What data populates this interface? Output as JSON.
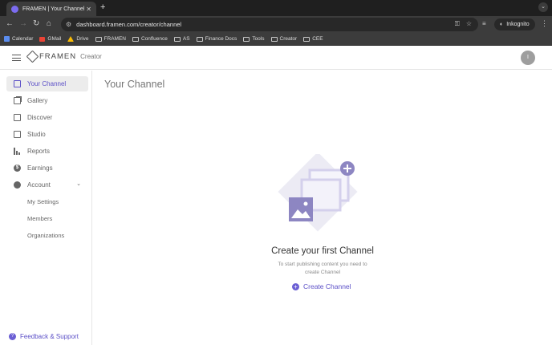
{
  "browser": {
    "tab_title": "FRAMEN | Your Channel",
    "url": "dashboard.framen.com/creator/channel",
    "incognito_label": "Inkognito",
    "bookmarks": [
      {
        "label": "Calendar",
        "icon": "calendar-icon"
      },
      {
        "label": "GMail",
        "icon": "gmail-icon"
      },
      {
        "label": "Drive",
        "icon": "drive-icon"
      },
      {
        "label": "FRAMEN",
        "icon": "folder-icon"
      },
      {
        "label": "Confluence",
        "icon": "folder-icon"
      },
      {
        "label": "AS",
        "icon": "folder-icon"
      },
      {
        "label": "Finance Docs",
        "icon": "folder-icon"
      },
      {
        "label": "Tools",
        "icon": "folder-icon"
      },
      {
        "label": "Creator",
        "icon": "folder-icon"
      },
      {
        "label": "CEE",
        "icon": "folder-icon"
      }
    ]
  },
  "header": {
    "brand": "FRAMEN",
    "subbrand": "Creator",
    "avatar_initial": "I"
  },
  "sidebar": {
    "items": [
      {
        "label": "Your Channel",
        "icon": "channel-icon",
        "active": true
      },
      {
        "label": "Gallery",
        "icon": "gallery-icon"
      },
      {
        "label": "Discover",
        "icon": "discover-icon"
      },
      {
        "label": "Studio",
        "icon": "studio-icon"
      },
      {
        "label": "Reports",
        "icon": "reports-icon"
      },
      {
        "label": "Earnings",
        "icon": "earnings-icon"
      },
      {
        "label": "Account",
        "icon": "account-icon",
        "expanded": true
      }
    ],
    "subitems": [
      "My Settings",
      "Members",
      "Organizations"
    ],
    "feedback": "Feedback & Support"
  },
  "main": {
    "title": "Your Channel",
    "empty_title": "Create your first Channel",
    "empty_desc": "To start publishing content you need to create Channel",
    "create_button": "Create Channel"
  },
  "colors": {
    "accent": "#5b4fc7",
    "active_bg": "#ececec",
    "chrome_dark": "#3c3c3c"
  }
}
